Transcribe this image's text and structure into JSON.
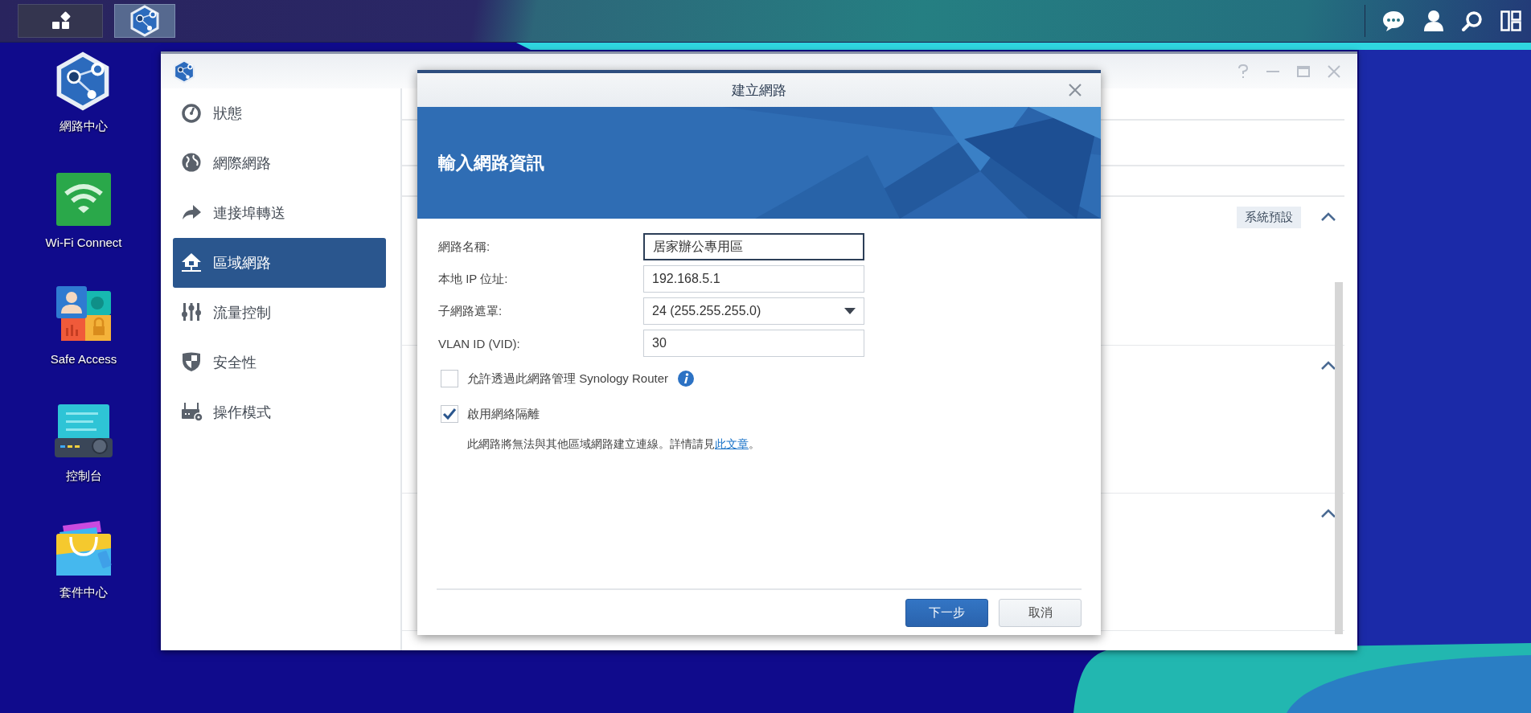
{
  "taskbar": {
    "buttons": [
      {
        "kind": "main-menu",
        "selected": false
      },
      {
        "kind": "network-center",
        "selected": true
      }
    ]
  },
  "desktop_icons": [
    {
      "kind": "network-center",
      "label": "網路中心"
    },
    {
      "kind": "wifi",
      "label": "Wi-Fi Connect"
    },
    {
      "kind": "safe-access",
      "label": "Safe Access"
    },
    {
      "kind": "control-panel",
      "label": "控制台"
    },
    {
      "kind": "package-center",
      "label": "套件中心"
    }
  ],
  "window": {
    "sidebar": {
      "items": [
        {
          "kind": "gauge",
          "label": "狀態",
          "selected": false
        },
        {
          "kind": "globe",
          "label": "網際網路",
          "selected": false
        },
        {
          "kind": "forward",
          "label": "連接埠轉送",
          "selected": false
        },
        {
          "kind": "home-network",
          "label": "區域網路",
          "selected": true
        },
        {
          "kind": "sliders",
          "label": "流量控制",
          "selected": false
        },
        {
          "kind": "shield",
          "label": "安全性",
          "selected": false
        },
        {
          "kind": "router",
          "label": "操作模式",
          "selected": false
        }
      ]
    },
    "sections": [
      {
        "tag": "系統預設",
        "expanded": true
      },
      {
        "expanded": true
      },
      {
        "expanded": true
      }
    ]
  },
  "dialog": {
    "title": "建立網路",
    "heading": "輸入網路資訊",
    "fields": [
      {
        "kind": "text",
        "label": "網路名稱:",
        "value": "居家辦公專用區",
        "focused": true
      },
      {
        "kind": "text",
        "label": "本地 IP 位址:",
        "value": "192.168.5.1",
        "focused": false
      },
      {
        "kind": "select",
        "label": "子網路遮罩:",
        "value": "24 (255.255.255.0)",
        "focused": false
      },
      {
        "kind": "text",
        "label": "VLAN ID (VID):",
        "value": "30",
        "focused": false
      }
    ],
    "checkboxes": [
      {
        "label": "允許透過此網路管理 Synology Router",
        "checked": false,
        "info": true
      },
      {
        "label": "啟用網絡隔離",
        "checked": true,
        "info": false
      }
    ],
    "note": {
      "text": "此網路將無法與其他區域網路建立連線。詳情請見",
      "link": "此文章",
      "after": "。"
    },
    "buttons": [
      {
        "kind": "primary",
        "label": "下一步"
      },
      {
        "kind": "secondary",
        "label": "取消"
      }
    ]
  }
}
